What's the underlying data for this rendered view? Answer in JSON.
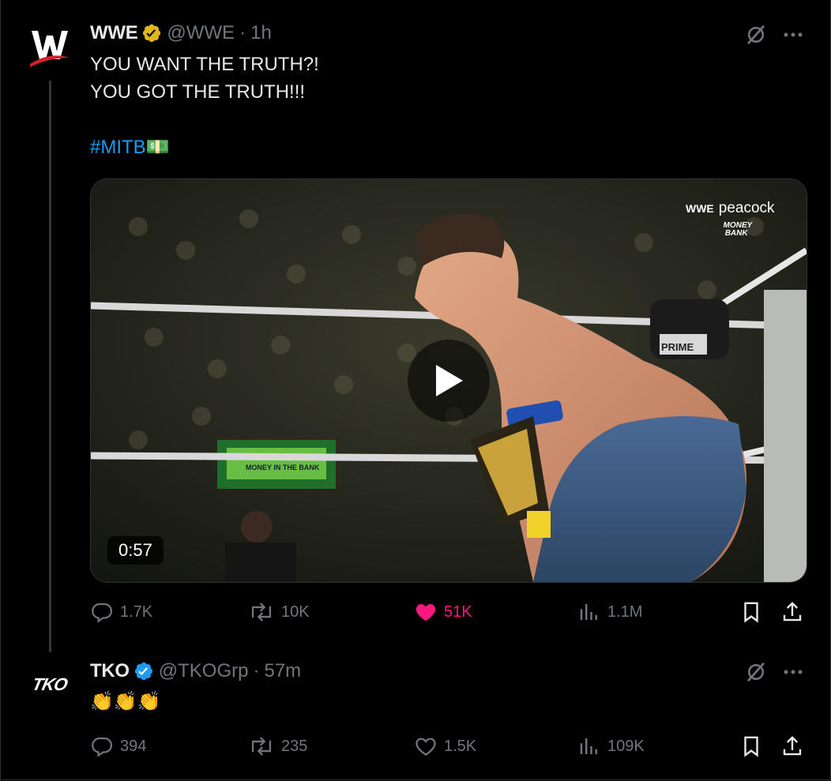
{
  "tweets": [
    {
      "author_name": "WWE",
      "handle": "@WWE",
      "time": "1h",
      "verified_color": "#e2b719",
      "text_lines": [
        "YOU WANT THE TRUTH?!",
        "YOU GOT THE TRUTH!!!"
      ],
      "hashtag": "#MITB",
      "hashtag_emoji": "💵",
      "video": {
        "duration": "0:57",
        "watermark_brand": "peacock",
        "watermark_logo": "WWE",
        "event_logo": "MONEY BANK",
        "sign_text": "PRIME",
        "banner_text": "MONEY IN THE BANK"
      },
      "stats": {
        "replies": "1.7K",
        "reposts": "10K",
        "likes": "51K",
        "views": "1.1M"
      },
      "liked": true
    },
    {
      "author_name": "TKO",
      "handle": "@TKOGrp",
      "time": "57m",
      "verified_color": "#1d9bf0",
      "text": "👏👏👏",
      "avatar_text": "TKO",
      "stats": {
        "replies": "394",
        "reposts": "235",
        "likes": "1.5K",
        "views": "109K"
      },
      "liked": false
    }
  ],
  "icons": [
    "grok-icon",
    "more-icon",
    "reply-icon",
    "repost-icon",
    "like-icon",
    "views-icon",
    "bookmark-icon",
    "share-icon",
    "play-icon"
  ],
  "colors": {
    "background": "#000000",
    "text": "#e7e9ea",
    "muted": "#71767b",
    "link": "#1d9bf0",
    "like": "#f91880"
  }
}
